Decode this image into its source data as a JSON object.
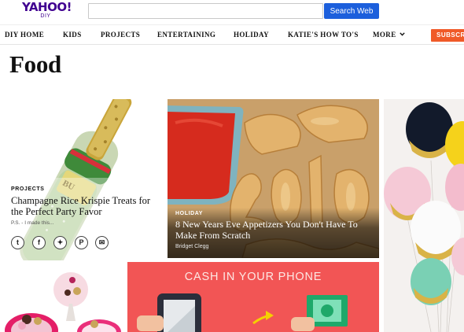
{
  "header": {
    "logo_main": "YAHOO!",
    "logo_sub": "DIY",
    "search_placeholder": "",
    "search_button": "Search Web"
  },
  "nav": {
    "items": [
      {
        "label": "DIY HOME"
      },
      {
        "label": "KIDS"
      },
      {
        "label": "PROJECTS"
      },
      {
        "label": "ENTERTAINING"
      },
      {
        "label": "HOLIDAY"
      },
      {
        "label": "KATIE'S HOW TO'S"
      },
      {
        "label": "MORE"
      }
    ],
    "subscribe": "SUBSCRIBE"
  },
  "page": {
    "title": "Food"
  },
  "cards": [
    {
      "category": "PROJECTS",
      "title": "Champagne Rice Krispie Treats for the Perfect Party Favor",
      "excerpt": "P.S. - I made this..."
    },
    {
      "category": "HOLIDAY",
      "title": "8 New Years Eve Appetizers You Don't Have To Make From Scratch",
      "author": "Bridget Clegg"
    },
    {
      "heading": "CASH IN YOUR PHONE"
    }
  ],
  "share": [
    {
      "icon": "tumblr-icon",
      "glyph": "t"
    },
    {
      "icon": "facebook-icon",
      "glyph": "f"
    },
    {
      "icon": "twitter-icon",
      "glyph": "✦"
    },
    {
      "icon": "pinterest-icon",
      "glyph": "P"
    },
    {
      "icon": "mail-icon",
      "glyph": "✉"
    }
  ],
  "colors": {
    "brand_purple": "#400090",
    "search_blue": "#1c5fdc",
    "subscribe_orange": "#f05a28",
    "cash_red": "#f25555"
  }
}
